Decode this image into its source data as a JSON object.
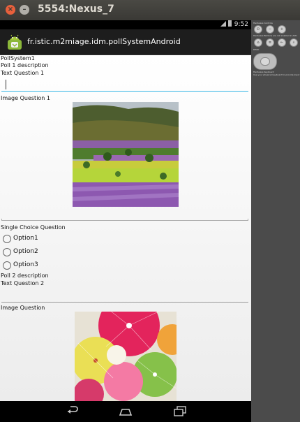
{
  "window": {
    "title": "5554:Nexus_7"
  },
  "statusbar": {
    "time": "9:52"
  },
  "actionbar": {
    "package": "fr.istic.m2miage.idm.pollSystemAndroid"
  },
  "content": {
    "poll_system_label": "PollSystem1",
    "poll1_description": "Poll 1 description",
    "text_question_1": "Text Question 1",
    "text_answer_1": "",
    "image_question_1": "Image Question 1",
    "single_choice_question": "Single Choice Question",
    "options": [
      "Option1",
      "Option2",
      "Option3"
    ],
    "poll2_description": "Poll 2 description",
    "text_question_2": "Text Question 2",
    "text_answer_2": "",
    "image_question_2": "Image Question"
  },
  "navbar": {
    "icons": [
      "back-icon",
      "home-icon",
      "recent-apps-icon"
    ]
  },
  "panel": {
    "hardware_controls": "Hardware Controls",
    "hardware_buttons": "Hardware Buttons are not enabled in AVD",
    "dpad": "DPAD",
    "dpad_note": "Hardware Keyboard",
    "keyboard_note": "Use your physical keyboard to provide input"
  }
}
